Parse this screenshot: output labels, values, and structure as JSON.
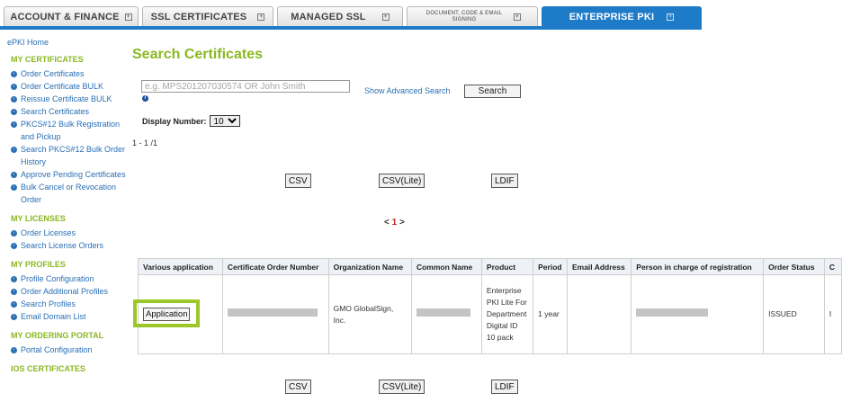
{
  "tabs": [
    {
      "label": "ACCOUNT & FINANCE",
      "active": false
    },
    {
      "label": "SSL CERTIFICATES",
      "active": false
    },
    {
      "label": "MANAGED SSL",
      "active": false
    },
    {
      "label": "DOCUMENT, CODE & EMAIL SIGNING",
      "active": false
    },
    {
      "label": "ENTERPRISE PKI",
      "active": true
    }
  ],
  "sidebar": {
    "home": "ePKI Home",
    "sections": [
      {
        "title": "MY CERTIFICATES",
        "items": [
          "Order Certificates",
          "Order Certificate BULK",
          "Reissue Certificate BULK",
          "Search Certificates",
          "PKCS#12 Bulk Registration and Pickup",
          "Search PKCS#12 Bulk Order History",
          "Approve Pending Certificates",
          "Bulk Cancel or Revocation Order"
        ]
      },
      {
        "title": "MY LICENSES",
        "items": [
          "Order Licenses",
          "Search License Orders"
        ]
      },
      {
        "title": "MY PROFILES",
        "items": [
          "Profile Configuration",
          "Order Additional Profiles",
          "Search Profiles",
          "Email Domain List"
        ]
      },
      {
        "title": "MY ORDERING PORTAL",
        "items": [
          "Portal Configuration"
        ]
      },
      {
        "title": "IOS CERTIFICATES",
        "items": []
      }
    ]
  },
  "page": {
    "title": "Search Certificates",
    "search_placeholder": "e.g. MPS201207030574 OR John Smith",
    "advanced_link": "Show Advanced Search",
    "search_button": "Search",
    "display_number_label": "Display Number:",
    "display_number_value": "10",
    "range": "1 - 1 /1",
    "export": {
      "csv": "CSV",
      "csv_lite": "CSV(Lite)",
      "ldif": "LDIF"
    },
    "pager": {
      "prev": "<",
      "current": "1",
      "next": ">"
    }
  },
  "table": {
    "headers": [
      "Various application",
      "Certificate Order Number",
      "Organization Name",
      "Common Name",
      "Product",
      "Period",
      "Email Address",
      "Person in charge of registration",
      "Order Status",
      "C"
    ],
    "rows": [
      {
        "application_button": "Application",
        "order_number": "",
        "organization": "GMO GlobalSign, Inc.",
        "common_name": "",
        "product": "Enterprise PKI Lite For Department Digital ID 10 pack",
        "period": "1 year",
        "email": "",
        "person": "",
        "status": "ISSUED",
        "extra": "I"
      }
    ]
  },
  "colors": {
    "brand_green": "#8ab823",
    "brand_blue": "#1e7bc8",
    "link": "#2a6fb5",
    "highlight": "#9bc826"
  }
}
